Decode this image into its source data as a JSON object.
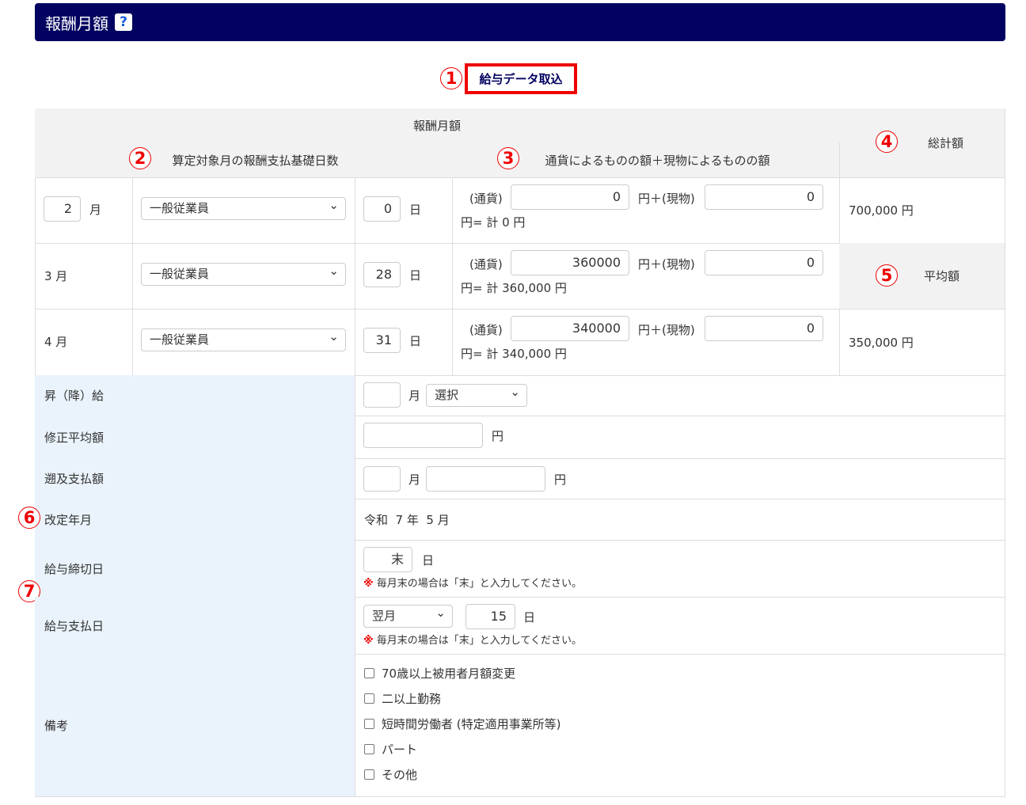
{
  "title": "報酬月額",
  "help_icon": "?",
  "import_button": "給与データ取込",
  "markers": [
    "1",
    "2",
    "3",
    "4",
    "5",
    "6",
    "7"
  ],
  "header": {
    "group": "報酬月額",
    "col_days": "算定対象月の報酬支払基礎日数",
    "col_amount": "通貨によるものの額＋現物によるものの額",
    "total_label": "総計額",
    "avg_label": "平均額"
  },
  "rows": [
    {
      "month": "2",
      "month_unit": "月",
      "type": "一般従業員",
      "days": "0",
      "day_unit": "日",
      "cash_label": "(通貨)",
      "cash": "0",
      "kind_label": "円＋(現物)",
      "kind": "0",
      "sum": "円= 計 0 円"
    },
    {
      "month_text": "3 月",
      "type": "一般従業員",
      "days": "28",
      "day_unit": "日",
      "cash_label": "(通貨)",
      "cash": "360000",
      "kind_label": "円＋(現物)",
      "kind": "0",
      "sum": "円= 計 360,000 円"
    },
    {
      "month_text": "4 月",
      "type": "一般従業員",
      "days": "31",
      "day_unit": "日",
      "cash_label": "(通貨)",
      "cash": "340000",
      "kind_label": "円＋(現物)",
      "kind": "0",
      "sum": "円= 計 340,000 円"
    }
  ],
  "total_value": "700,000 円",
  "avg_value": "350,000 円",
  "raise": {
    "label": "昇（降）給",
    "month": "",
    "month_unit": "月",
    "select": "選択"
  },
  "corrected_avg": {
    "label": "修正平均額",
    "value": "",
    "unit": "円"
  },
  "retro": {
    "label": "遡及支払額",
    "month": "",
    "month_unit": "月",
    "value": "",
    "unit": "円"
  },
  "revision": {
    "label": "改定年月",
    "value": "令和  7 年  5 月"
  },
  "closing": {
    "label": "給与締切日",
    "value": "末",
    "unit": "日",
    "note_mark": "※",
    "note": "毎月末の場合は「末」と入力してください。"
  },
  "payday": {
    "label": "給与支払日",
    "select": "翌月",
    "value": "15",
    "unit": "日",
    "note_mark": "※",
    "note": "毎月末の場合は「末」と入力してください。"
  },
  "remarks": {
    "label": "備考",
    "options": [
      "70歳以上被用者月額変更",
      "二以上勤務",
      "短時間労働者 (特定適用事業所等)",
      "パート",
      "その他"
    ]
  }
}
